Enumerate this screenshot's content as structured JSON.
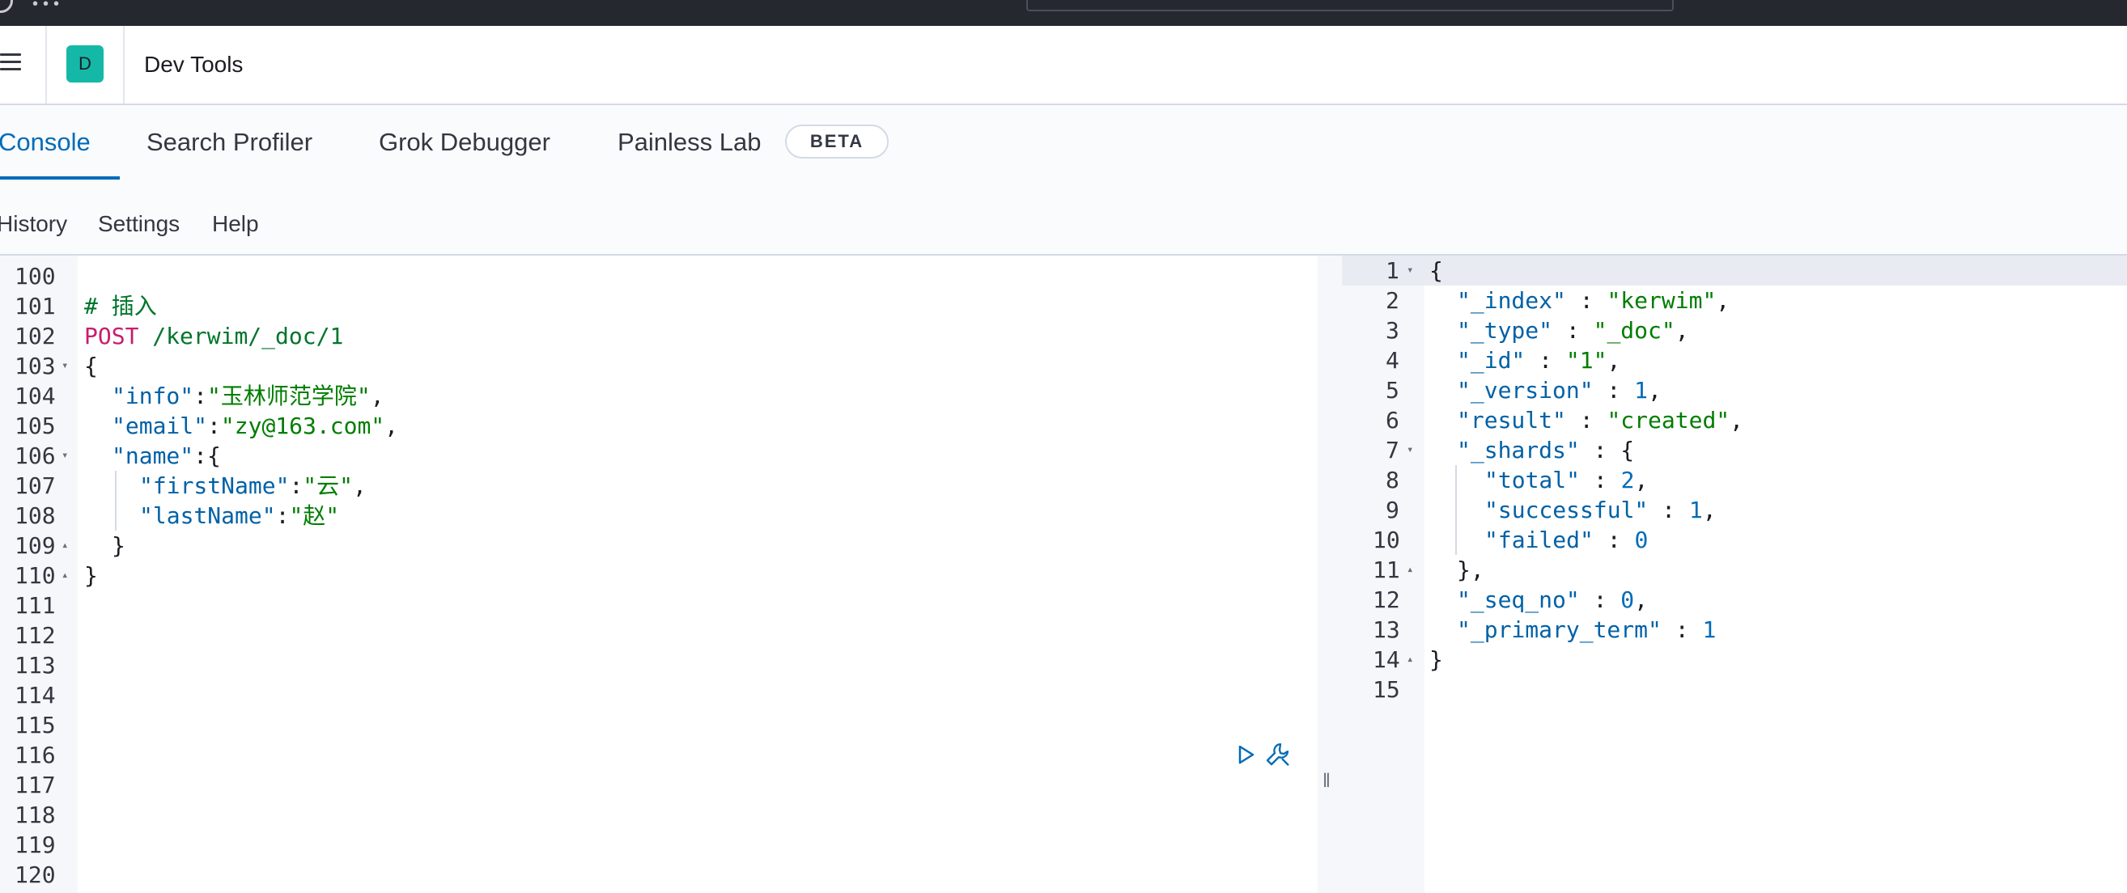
{
  "header": {
    "avatar_letter": "D",
    "title": "Dev Tools"
  },
  "tabs": [
    {
      "label": "Console",
      "active": true
    },
    {
      "label": "Search Profiler",
      "active": false
    },
    {
      "label": "Grok Debugger",
      "active": false
    },
    {
      "label": "Painless Lab",
      "active": false
    }
  ],
  "beta_badge": "BETA",
  "submenu": {
    "history": "History",
    "settings": "Settings",
    "help": "Help"
  },
  "request_editor": {
    "line_numbers": [
      "100",
      "101",
      "102",
      "103",
      "104",
      "105",
      "106",
      "107",
      "108",
      "109",
      "110",
      "111",
      "112",
      "113",
      "114",
      "115",
      "116",
      "117",
      "118",
      "119",
      "120"
    ],
    "lines": {
      "comment": "# 插入",
      "method": "POST",
      "url": " /kerwim/_doc/1",
      "open_brace": "{",
      "info_key": "\"info\"",
      "info_value": "\"玉林师范学院\"",
      "email_key": "\"email\"",
      "email_value": "\"zy@163.com\"",
      "name_key": "\"name\"",
      "firstname_key": "\"firstName\"",
      "firstname_value": "\"云\"",
      "lastname_key": "\"lastName\"",
      "lastname_value": "\"赵\"",
      "inner_close": "}",
      "close_brace": "}"
    }
  },
  "response_editor": {
    "line_numbers": [
      "1",
      "2",
      "3",
      "4",
      "5",
      "6",
      "7",
      "8",
      "9",
      "10",
      "11",
      "12",
      "13",
      "14",
      "15"
    ],
    "lines": {
      "open": "{",
      "index_key": "\"_index\"",
      "index_val": "\"kerwim\"",
      "type_key": "\"_type\"",
      "type_val": "\"_doc\"",
      "id_key": "\"_id\"",
      "id_val": "\"1\"",
      "version_key": "\"_version\"",
      "version_val": "1",
      "result_key": "\"result\"",
      "result_val": "\"created\"",
      "shards_key": "\"_shards\"",
      "total_key": "\"total\"",
      "total_val": "2",
      "successful_key": "\"successful\"",
      "successful_val": "1",
      "failed_key": "\"failed\"",
      "failed_val": "0",
      "shards_close": "}",
      "seq_key": "\"_seq_no\"",
      "seq_val": "0",
      "term_key": "\"_primary_term\"",
      "term_val": "1",
      "close": "}"
    }
  },
  "icons": {
    "play": "play-icon",
    "wrench": "wrench-icon",
    "menu": "hamburger-menu-icon"
  }
}
